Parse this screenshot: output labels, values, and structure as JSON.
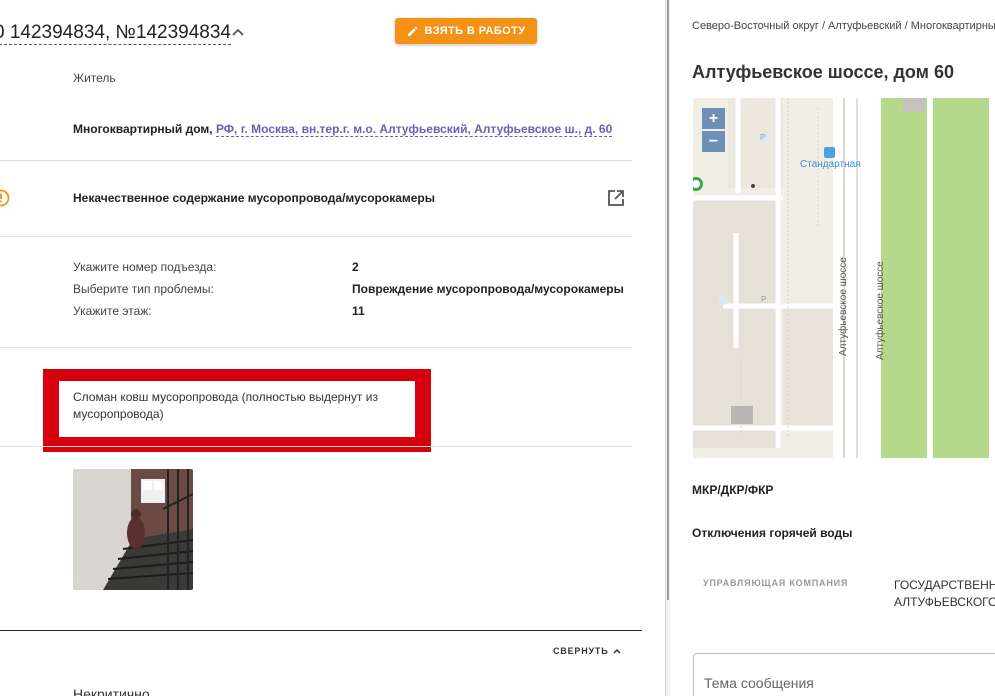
{
  "header": {
    "title": "0 142394834, №142394834",
    "take_button": "ВЗЯТЬ В РАБОТУ"
  },
  "applicant": {
    "type": "Житель"
  },
  "object": {
    "kind": "Многоквартирный дом,",
    "address": "РФ, г. Москва, вн.тер.г. м.о. Алтуфьевский, Алтуфьевское ш., д. 60"
  },
  "category": {
    "name": "Некачественное содержание мусоропровода/мусорокамеры"
  },
  "details": [
    {
      "label": "Укажите номер подъезда:",
      "value": "2"
    },
    {
      "label": "Выберите тип проблемы:",
      "value": "Повреждение мусоропровода/мусорокамеры"
    },
    {
      "label": "Укажите этаж:",
      "value": "11"
    }
  ],
  "description": "Сломан ковш мусоропровода (полностью выдернут из мусоропровода)",
  "collapse_label": "СВЕРНУТЬ",
  "priority": "Некритично",
  "right": {
    "breadcrumbs": "Северо-Восточный округ / Алтуфьевский / Многоквартирный",
    "address_title": "Алтуфьевское шоссе, дом 60",
    "map": {
      "zoom_in": "+",
      "zoom_out": "−",
      "stop_name": "Стандартная",
      "street1": "Алтуфьевское шоссе",
      "street2": "Алтуфьевское шоссе",
      "parking": "P"
    },
    "section_mkr": "МКР/ДКР/ФКР",
    "section_hot_water": "Отключения горячей воды",
    "uk_label": "УПРАВЛЯЮЩАЯ КОМПАНИЯ",
    "uk_value_line1": "ГОСУДАРСТВЕННОЕ",
    "uk_value_line2": "АЛТУФЬЕВСКОГО",
    "message_placeholder": "Тема сообщения"
  },
  "colors": {
    "accent_orange": "#f39214",
    "highlight_red": "#d7000e",
    "link_purple": "#6b5fb5",
    "map_green": "#b5d98a"
  }
}
